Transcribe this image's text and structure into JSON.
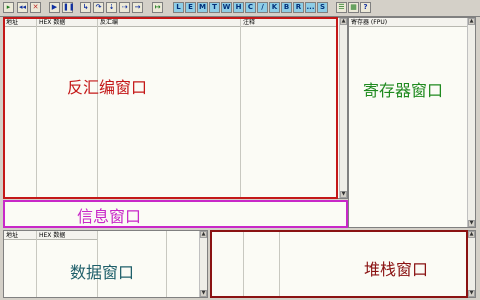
{
  "toolbar": {
    "letter_buttons": [
      "L",
      "E",
      "M",
      "T",
      "W",
      "H",
      "C",
      "/",
      "K",
      "B",
      "R",
      "...",
      "S"
    ]
  },
  "disasm": {
    "columns": [
      "地址",
      "HEX 数据",
      "反汇编",
      "注释"
    ],
    "label": "反汇编窗口"
  },
  "registers": {
    "header": "寄存器 (FPU)",
    "label": "寄存器窗口"
  },
  "info": {
    "label": "信息窗口"
  },
  "dump": {
    "columns": [
      "地址",
      "HEX 数据"
    ],
    "label": "数据窗口"
  },
  "stack": {
    "label": "堆栈窗口"
  },
  "colors": {
    "disasm_border": "#c41818",
    "info_border": "#c828c8",
    "register_text": "#1f8a1f",
    "dump_text": "#1f5f6a",
    "stack_border": "#8a1212"
  }
}
